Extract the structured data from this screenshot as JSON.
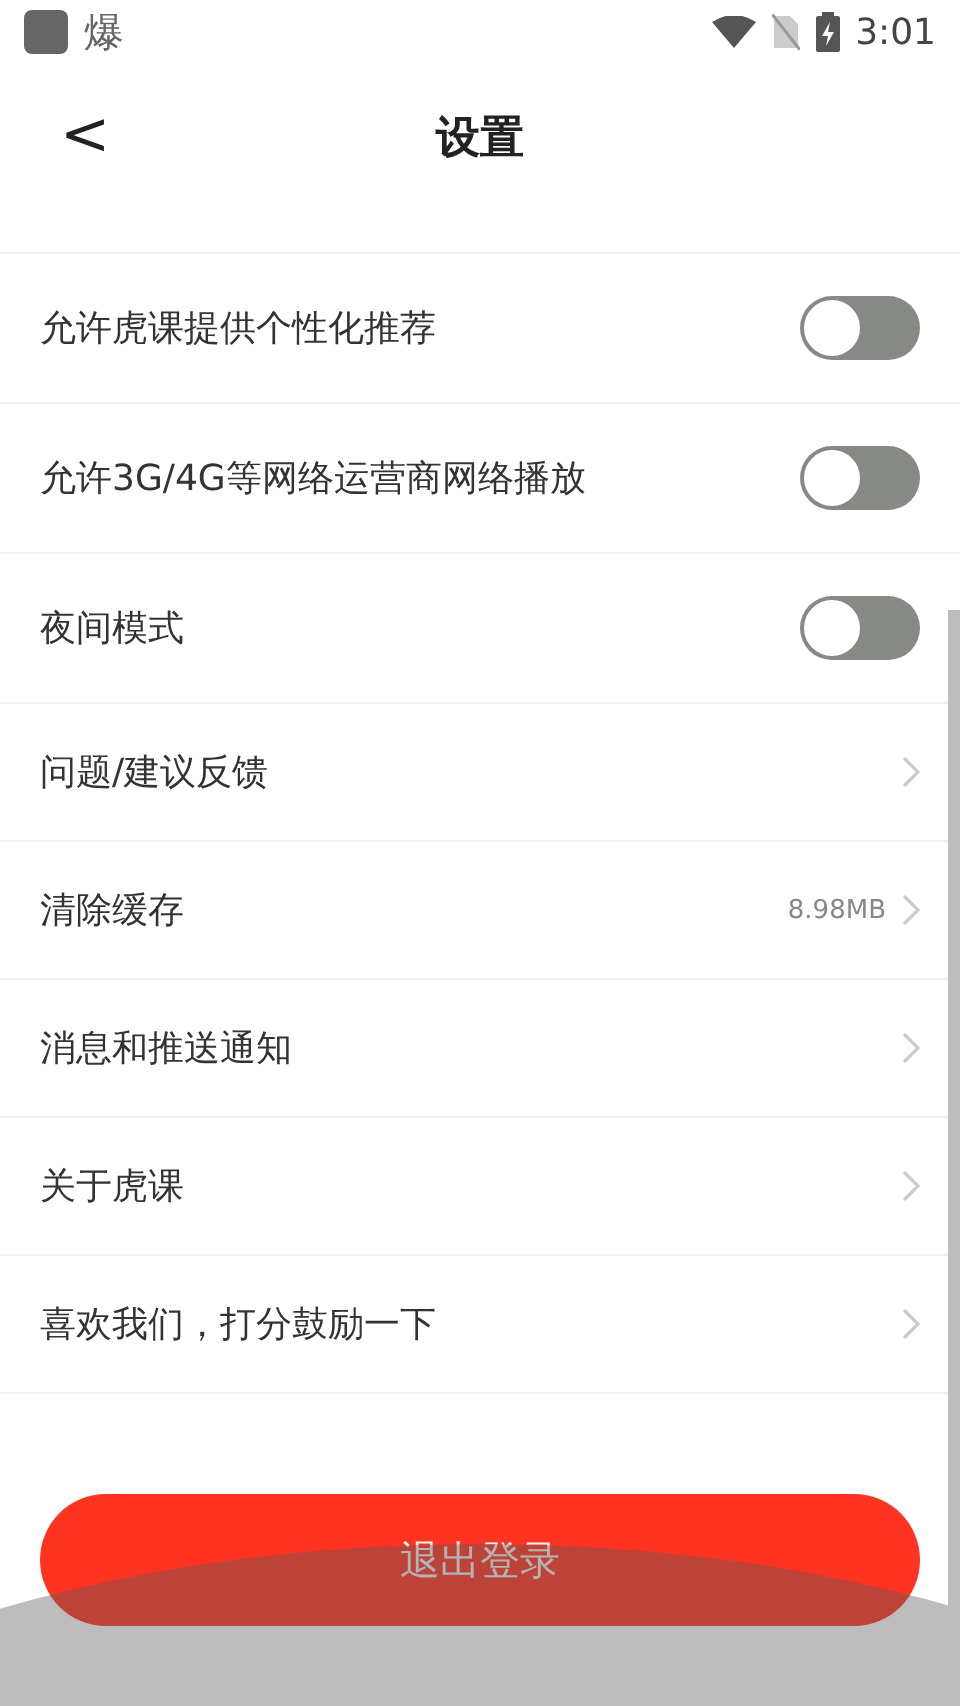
{
  "status_bar": {
    "app_glyph": "爆",
    "time": "3:01"
  },
  "header": {
    "back": "<",
    "title": "设置"
  },
  "settings": [
    {
      "kind": "toggle",
      "label": "允许虎课提供个性化推荐",
      "on": false
    },
    {
      "kind": "toggle",
      "label": "允许3G/4G等网络运营商网络播放",
      "on": false
    },
    {
      "kind": "toggle",
      "label": "夜间模式",
      "on": false
    },
    {
      "kind": "link",
      "label": "问题/建议反馈"
    },
    {
      "kind": "link",
      "label": "清除缓存",
      "value": "8.98MB"
    },
    {
      "kind": "link",
      "label": "消息和推送通知"
    },
    {
      "kind": "link",
      "label": "关于虎课"
    },
    {
      "kind": "link",
      "label": "喜欢我们，打分鼓励一下"
    }
  ],
  "logout_button": "退出登录"
}
